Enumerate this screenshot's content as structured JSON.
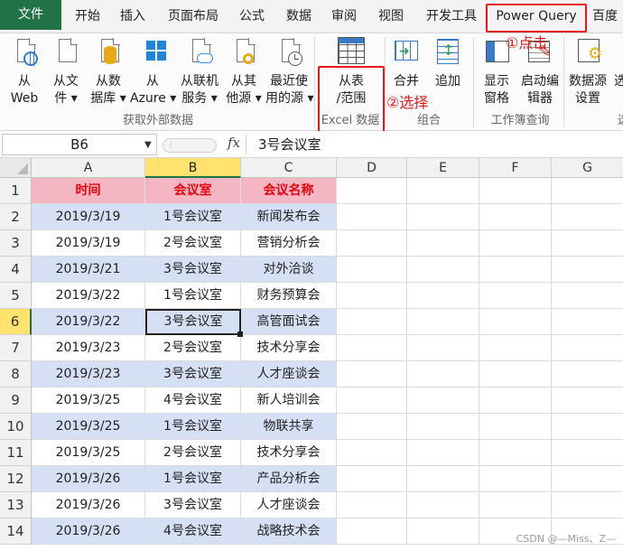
{
  "tabs": [
    "文件",
    "开始",
    "插入",
    "页面布局",
    "公式",
    "数据",
    "审阅",
    "视图",
    "开发工具",
    "Power Query",
    "百度"
  ],
  "ribbon": {
    "buttons": [
      {
        "line1": "从",
        "line2": "Web",
        "icon": "web-globe-icon"
      },
      {
        "line1": "从文",
        "line2": "件 ▾",
        "icon": "file-icon"
      },
      {
        "line1": "从数",
        "line2": "据库 ▾",
        "icon": "database-icon"
      },
      {
        "line1": "从",
        "line2": "Azure ▾",
        "icon": "azure-icon"
      },
      {
        "line1": "从联机",
        "line2": "服务 ▾",
        "icon": "cloud-icon"
      },
      {
        "line1": "从其",
        "line2": "他源 ▾",
        "icon": "other-source-icon"
      },
      {
        "line1": "最近使",
        "line2": "用的源 ▾",
        "icon": "recent-icon"
      },
      {
        "line1": "从表",
        "line2": "/范围",
        "icon": "table-icon"
      },
      {
        "line1": "合并",
        "line2": "",
        "icon": "merge-icon"
      },
      {
        "line1": "追加",
        "line2": "",
        "icon": "append-icon"
      },
      {
        "line1": "显示",
        "line2": "窗格",
        "icon": "pane-icon"
      },
      {
        "line1": "启动编",
        "line2": "辑器",
        "icon": "editor-icon"
      },
      {
        "line1": "数据源",
        "line2": "设置",
        "icon": "datasource-settings-icon"
      },
      {
        "line1": "选",
        "line2": "",
        "icon": ""
      }
    ],
    "groups": [
      "获取外部数据",
      "Excel 数据",
      "组合",
      "工作簿查询",
      "选"
    ]
  },
  "annotations": {
    "step1": "①点击",
    "step2": "②选择"
  },
  "formula_bar": {
    "name_box": "B6",
    "fx": "fx",
    "value": "3号会议室"
  },
  "sheet": {
    "columns": [
      "A",
      "B",
      "C",
      "D",
      "E",
      "F",
      "G"
    ],
    "rows": [
      "1",
      "2",
      "3",
      "4",
      "5",
      "6",
      "7",
      "8",
      "9",
      "10",
      "11",
      "12",
      "13",
      "14"
    ],
    "header": [
      "时间",
      "会议室",
      "会议名称"
    ],
    "data": [
      [
        "2019/3/19",
        "1号会议室",
        "新闻发布会"
      ],
      [
        "2019/3/19",
        "2号会议室",
        "营销分析会"
      ],
      [
        "2019/3/21",
        "3号会议室",
        "对外洽谈"
      ],
      [
        "2019/3/22",
        "1号会议室",
        "财务预算会"
      ],
      [
        "2019/3/22",
        "3号会议室",
        "高管面试会"
      ],
      [
        "2019/3/23",
        "2号会议室",
        "技术分享会"
      ],
      [
        "2019/3/23",
        "3号会议室",
        "人才座谈会"
      ],
      [
        "2019/3/25",
        "4号会议室",
        "新人培训会"
      ],
      [
        "2019/3/25",
        "1号会议室",
        "物联共享"
      ],
      [
        "2019/3/25",
        "2号会议室",
        "技术分享会"
      ],
      [
        "2019/3/26",
        "1号会议室",
        "产品分析会"
      ],
      [
        "2019/3/26",
        "3号会议室",
        "人才座谈会"
      ],
      [
        "2019/3/26",
        "4号会议室",
        "战略技术会"
      ]
    ]
  },
  "watermark": "CSDN @—Miss、Z—"
}
